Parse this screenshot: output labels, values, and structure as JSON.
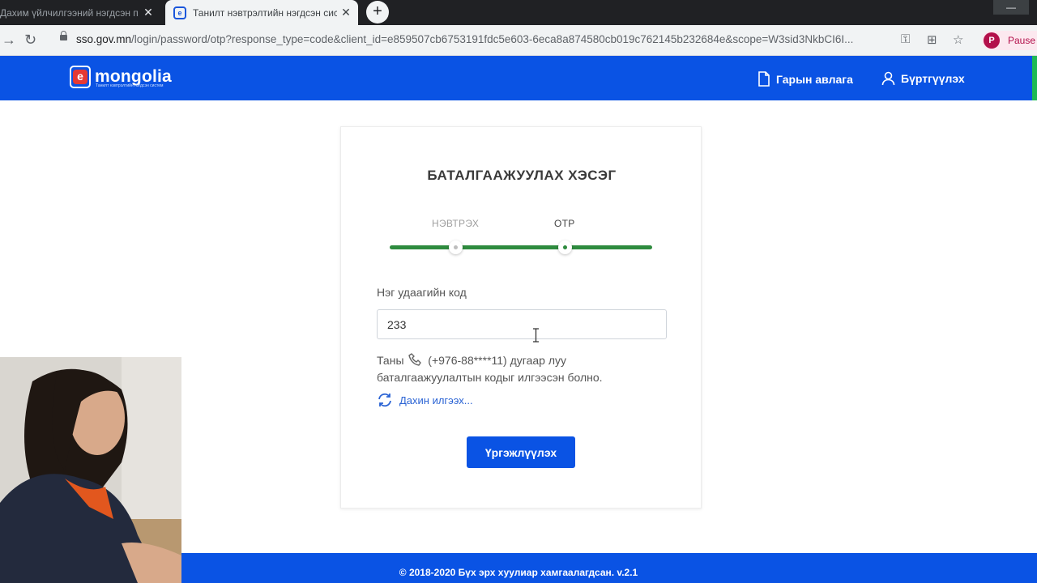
{
  "browser": {
    "tabs": [
      {
        "title": "Дахим үйлчилгээний нэгдсэн п",
        "active": false
      },
      {
        "title": "Танилт нэвтрэлтийн нэгдсэн сис",
        "active": true
      }
    ],
    "new_tab": "+",
    "url_host": "sso.gov.mn",
    "url_path": "/login/password/otp?response_type=code&client_id=e859507cb6753191fdc5e603-6eca8a874580cb019c762145b232684e&scope=W3sid3NkbCI6I...",
    "profile_initial": "P",
    "profile_label": "Pause"
  },
  "header": {
    "logo_text": "mongolia",
    "logo_letter": "e",
    "logo_tagline": "Танилт нэвтрэлтийн нэгдсэн систем",
    "link_manual": "Гарын авлага",
    "link_register": "Бүртгүүлэх"
  },
  "card": {
    "title": "БАТАЛГААЖУУЛАХ ХЭСЭГ",
    "steps": [
      {
        "label": "НЭВТРЭХ",
        "active": false
      },
      {
        "label": "OTP",
        "active": true
      }
    ],
    "field_label": "Нэг удаагийн код",
    "otp_value": "233",
    "info_prefix": "Таны",
    "info_phone": "(+976-88****11) дугаар луу",
    "info_line2": "баталгаажуулалтын кодыг илгээсэн болно.",
    "resend_label": "Дахин илгээх...",
    "continue_label": "Үргэжлүүлэх"
  },
  "footer": {
    "text": "© 2018-2020 Бүх эрх хуулиар хамгаалагдсан. v.2.1"
  },
  "colors": {
    "brand_blue": "#0a53e4",
    "progress_green": "#2e8b3e",
    "logo_red": "#e53935"
  }
}
